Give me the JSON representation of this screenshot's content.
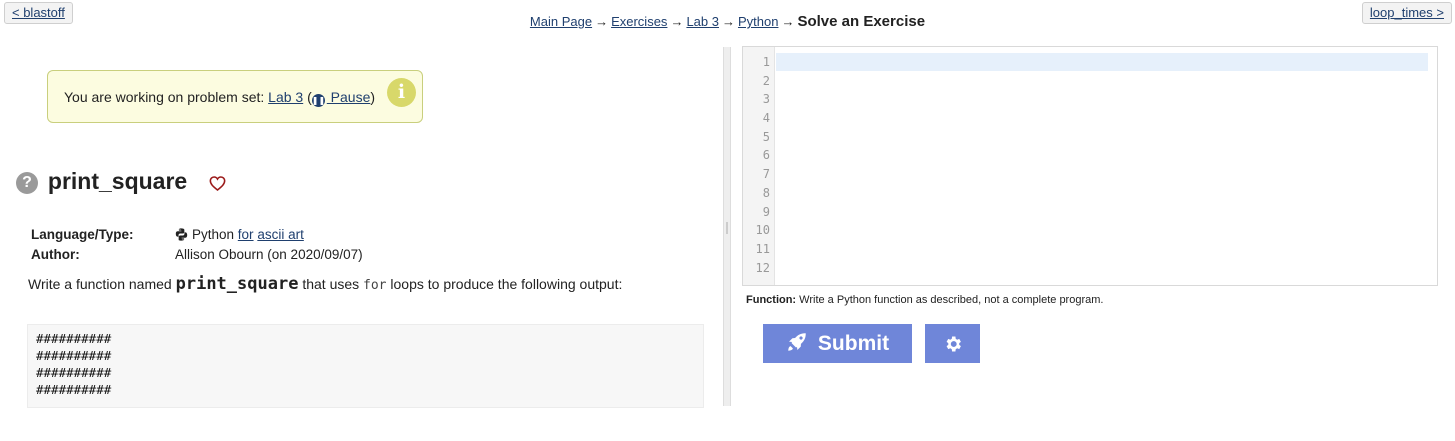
{
  "nav": {
    "prev_label": "< blastoff",
    "next_label": "loop_times >"
  },
  "breadcrumb": {
    "items": [
      "Main Page",
      "Exercises",
      "Lab 3",
      "Python"
    ],
    "arrow": "→",
    "current": "Solve an Exercise"
  },
  "notice": {
    "prefix": "You are working on problem set: ",
    "set_link": "Lab 3",
    "open_paren": " (",
    "pause_label": " Pause",
    "close_paren": ")",
    "info_glyph": "i",
    "colors": {
      "background": "#fcfce0",
      "border": "#c9cf7d",
      "info": "#d8d86a"
    }
  },
  "problem": {
    "help_glyph": "?",
    "title": "print_square",
    "meta": {
      "language_key": "Language/Type:",
      "language_value": "Python",
      "for_link": "for",
      "tag_link": "ascii art",
      "author_key": "Author:",
      "author_value": "Allison Obourn (on 2020/09/07)"
    },
    "description": {
      "part1": "Write a function named ",
      "function_name": "print_square",
      "part2": " that uses ",
      "keyword": "for",
      "part3": " loops to produce the following output:"
    },
    "expected_output": "##########\n##########\n##########\n##########"
  },
  "editor": {
    "line_numbers": [
      "1",
      "2",
      "3",
      "4",
      "5",
      "6",
      "7",
      "8",
      "9",
      "10",
      "11",
      "12"
    ],
    "active_line": 1
  },
  "function_note": {
    "label": "Function:",
    "text": " Write a Python function as described, not a complete program."
  },
  "actions": {
    "submit_label": "Submit",
    "submit_icon": "rocket-icon",
    "settings_icon": "gear-icon",
    "button_color": "#6f86d9"
  }
}
